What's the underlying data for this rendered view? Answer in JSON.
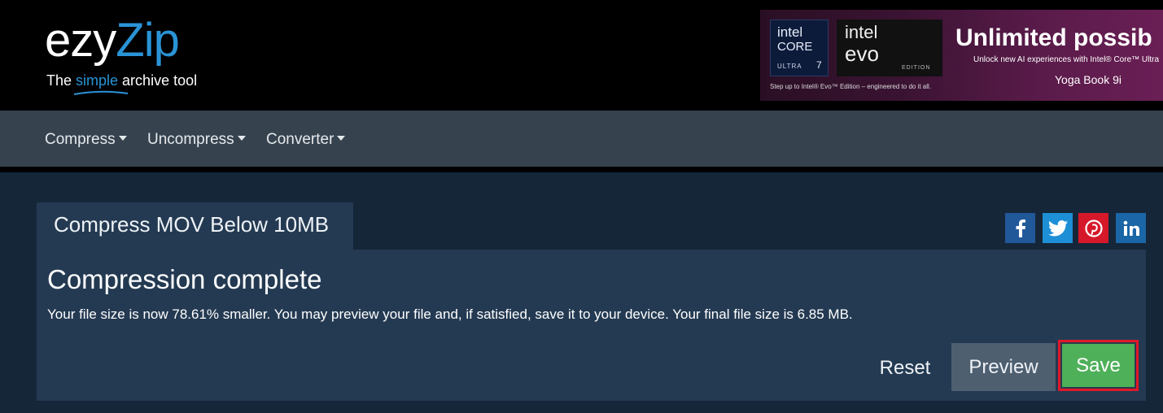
{
  "logo": {
    "name_part1": "ezy",
    "name_part2": "Zip",
    "tagline_pre": "The ",
    "tagline_highlight": "simple",
    "tagline_post": " archive tool",
    "brand_color": "#2a93d6"
  },
  "ad": {
    "chip1_line1": "intel",
    "chip1_line2": "CORE",
    "chip1_line3": "ULTRA",
    "chip1_tier": "7",
    "chip2_line1": "intel",
    "chip2_line2": "evo",
    "chip2_edition": "EDITION",
    "subtext": "Step up to Intel® Evo™ Edition – engineered to do it all.",
    "headline": "Unlimited possib",
    "tagline": "Unlock new AI experiences with Intel® Core™ Ultra",
    "model": "Yoga Book 9i"
  },
  "nav": {
    "items": [
      {
        "label": "Compress"
      },
      {
        "label": "Uncompress"
      },
      {
        "label": "Converter"
      }
    ]
  },
  "tab": {
    "title": "Compress MOV Below 10MB"
  },
  "social": {
    "icons": [
      "facebook-icon",
      "twitter-icon",
      "pinterest-icon",
      "linkedin-icon"
    ],
    "colors": {
      "facebook": "#21589a",
      "twitter": "#1d8fd6",
      "pinterest": "#d6192a",
      "linkedin": "#1a66a6"
    }
  },
  "result": {
    "title": "Compression complete",
    "message": "Your file size is now 78.61% smaller. You may preview your file and, if satisfied, save it to your device. Your final file size is 6.85 MB."
  },
  "actions": {
    "reset_label": "Reset",
    "preview_label": "Preview",
    "save_label": "Save",
    "save_color": "#4fb05a",
    "highlight_color": "#e0182a"
  }
}
